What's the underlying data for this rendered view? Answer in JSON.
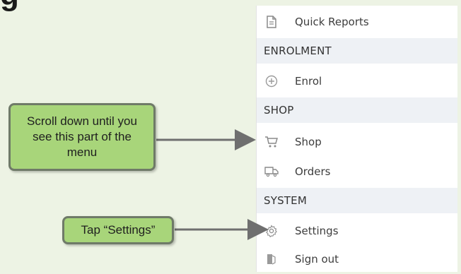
{
  "heading_partial": "g",
  "menu": {
    "items": [
      {
        "id": "quick-reports",
        "label": "Quick Reports",
        "icon": "document-icon"
      },
      {
        "id": "enrol",
        "label": "Enrol",
        "icon": "plus-circle-icon"
      },
      {
        "id": "shop",
        "label": "Shop",
        "icon": "cart-icon"
      },
      {
        "id": "orders",
        "label": "Orders",
        "icon": "truck-icon"
      },
      {
        "id": "settings",
        "label": "Settings",
        "icon": "gear-icon"
      },
      {
        "id": "sign-out",
        "label": "Sign out",
        "icon": "sign-out-icon"
      }
    ],
    "sections": {
      "enrolment": "ENROLMENT",
      "shop": "SHOP",
      "system": "SYSTEM"
    }
  },
  "callouts": {
    "scroll": "Scroll down until you see this part of the menu",
    "tap": "Tap “Settings”"
  },
  "colors": {
    "background": "#edf3e4",
    "callout_fill": "#a8d57a",
    "callout_border": "#6f7a68",
    "section_bg": "#eef1f5",
    "arrow": "#6f6f6f"
  }
}
